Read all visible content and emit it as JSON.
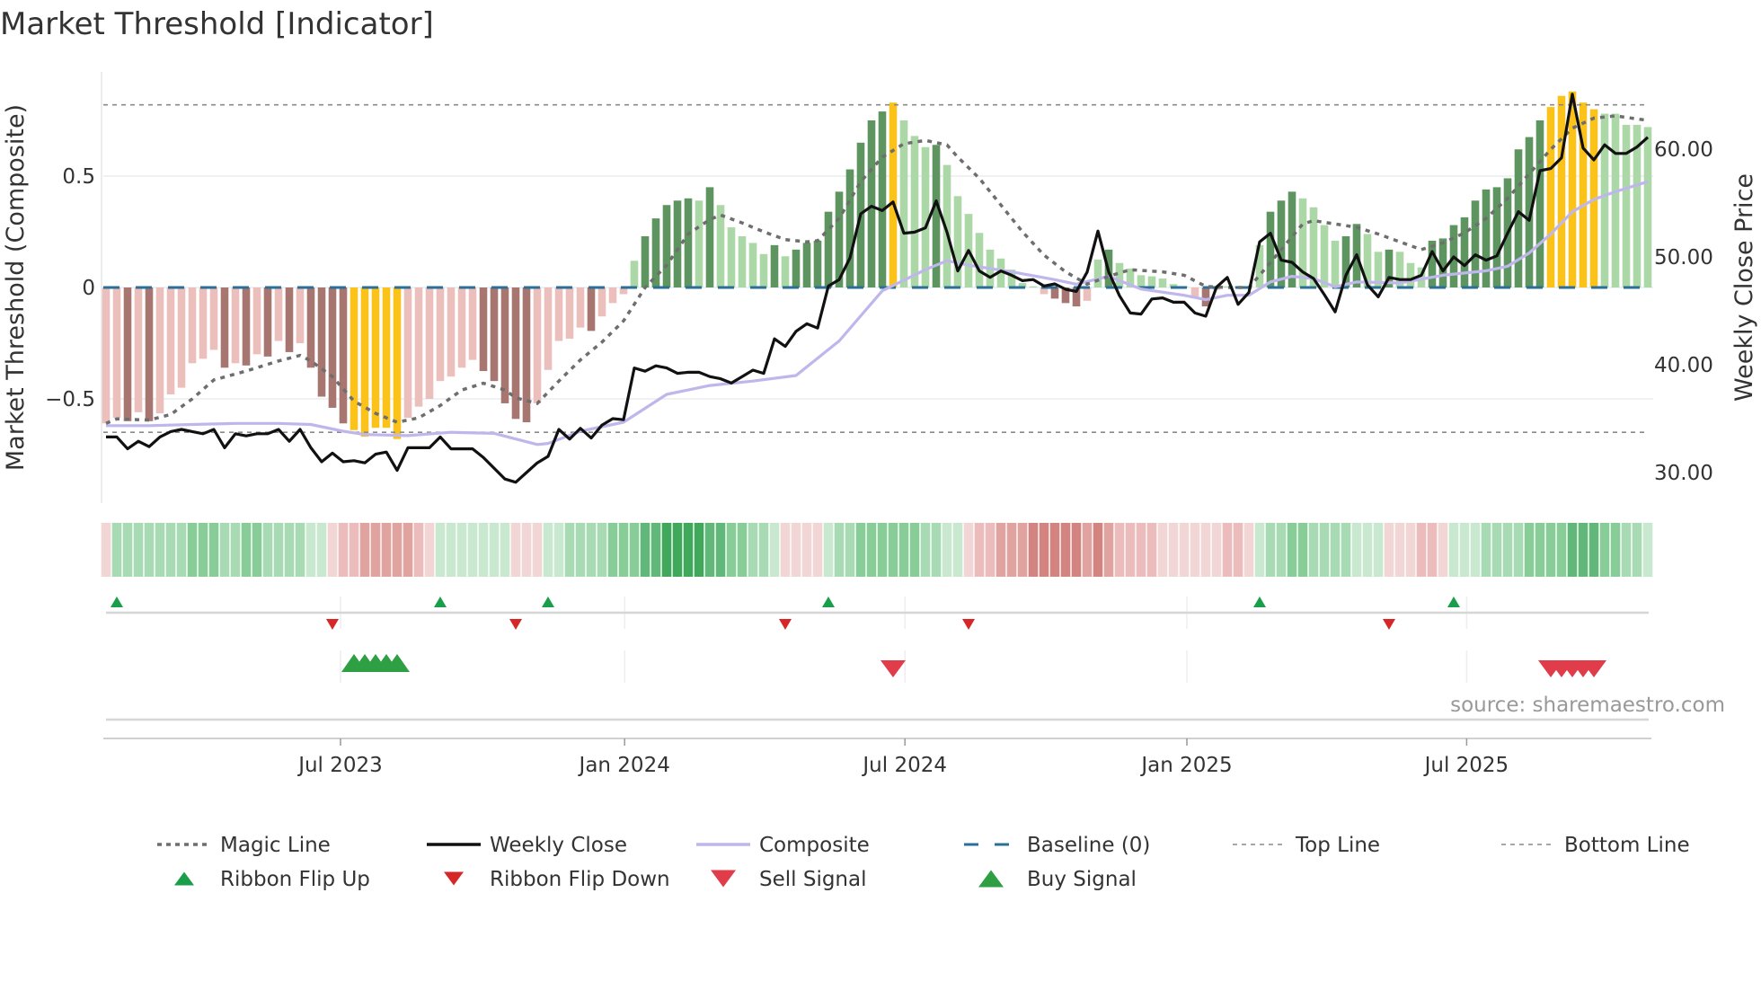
{
  "title": "Market Threshold [Indicator]",
  "source": "source: sharemaestro.com",
  "colors": {
    "bar_dark_neg": "#a87670",
    "bar_light_neg": "#ebc0bc",
    "bar_dark_pos": "#5e9460",
    "bar_light_pos": "#acd8a8",
    "bar_extreme": "#fbc31a",
    "magic": "#6e6e6e",
    "close": "#111111",
    "composite": "#bfb7ec",
    "baseline": "#2b6f98",
    "threshold": "#8a8a8a",
    "flip_up": "#1a9e4a",
    "flip_down": "#d62728",
    "buy": "#2ea043",
    "sell": "#e03c4a",
    "ribbon_pos": [
      "#c8e8cf",
      "#a8dab3",
      "#88cc98",
      "#62b87a",
      "#3fa85a"
    ],
    "ribbon_neg": [
      "#f2d6d6",
      "#ebbcbb",
      "#e0a3a0",
      "#d48480",
      "#c96a66"
    ]
  },
  "chart_data": {
    "type": "bar+line",
    "title": "Market Threshold [Indicator]",
    "x_unit": "week index (weekly bars)",
    "week_count": 144,
    "x_ticks": [
      {
        "label": "Jul 2023",
        "week": 22.75
      },
      {
        "label": "Jan 2024",
        "week": 49.1
      },
      {
        "label": "Jul 2024",
        "week": 75.1
      },
      {
        "label": "Jan 2025",
        "week": 101.25
      },
      {
        "label": "Jul 2025",
        "week": 127.2
      }
    ],
    "left_axis": {
      "label": "Market Threshold (Composite)",
      "ylim": [
        -1.0,
        1.0
      ],
      "ticks": [
        {
          "v": 0.5,
          "label": "0.5"
        },
        {
          "v": 0,
          "label": "0"
        },
        {
          "v": -0.5,
          "label": "−0.5"
        }
      ]
    },
    "right_axis": {
      "label": "Weekly Close Price",
      "ylim": [
        25,
        72
      ],
      "ticks": [
        {
          "v": 60,
          "label": "60.00"
        },
        {
          "v": 50,
          "label": "50.00"
        },
        {
          "v": 40,
          "label": "40.00"
        },
        {
          "v": 30,
          "label": "30.00"
        }
      ]
    },
    "top_line": 0.82,
    "bottom_line": -0.65,
    "baseline": 0,
    "bars": [
      -0.61,
      -0.585,
      -0.6,
      -0.56,
      -0.6,
      -0.565,
      -0.48,
      -0.45,
      -0.34,
      -0.32,
      -0.28,
      -0.36,
      -0.34,
      -0.35,
      -0.3,
      -0.31,
      -0.24,
      -0.29,
      -0.25,
      -0.36,
      -0.49,
      -0.54,
      -0.61,
      -0.64,
      -0.67,
      -0.63,
      -0.63,
      -0.68,
      -0.585,
      -0.535,
      -0.5,
      -0.42,
      -0.4,
      -0.36,
      -0.325,
      -0.375,
      -0.42,
      -0.52,
      -0.59,
      -0.605,
      -0.52,
      -0.37,
      -0.24,
      -0.23,
      -0.18,
      -0.195,
      -0.13,
      -0.07,
      -0.03,
      0.12,
      0.23,
      0.31,
      0.37,
      0.39,
      0.4,
      0.39,
      0.45,
      0.37,
      0.27,
      0.23,
      0.2,
      0.15,
      0.19,
      0.14,
      0.17,
      0.2,
      0.21,
      0.34,
      0.43,
      0.53,
      0.65,
      0.75,
      0.79,
      0.83,
      0.75,
      0.68,
      0.63,
      0.64,
      0.55,
      0.41,
      0.33,
      0.245,
      0.17,
      0.13,
      0.08,
      0.02,
      0.005,
      -0.03,
      -0.05,
      -0.07,
      -0.085,
      -0.06,
      0.125,
      0.17,
      0.11,
      0.085,
      0.055,
      0.05,
      0.04,
      0.015,
      0.005,
      -0.045,
      -0.085,
      -0.01,
      0.005,
      0.005,
      0.005,
      0.19,
      0.34,
      0.39,
      0.43,
      0.4,
      0.36,
      0.28,
      0.21,
      0.23,
      0.285,
      0.24,
      0.16,
      0.17,
      0.16,
      0.11,
      0.09,
      0.21,
      0.22,
      0.28,
      0.315,
      0.39,
      0.44,
      0.45,
      0.49,
      0.62,
      0.675,
      0.75,
      0.81,
      0.86,
      0.88,
      0.83,
      0.8,
      0.78,
      0.78,
      0.73,
      0.73,
      0.72
    ],
    "bar_shades": "LLDLDLLLLLLDLDLDLDLDDDDYYYYYLLLLLLLDDDDDLLLLLDLLLLDDDDDLDLLLLLDLDDDDDDDDDYLLLDLLLLLLLLLLDDDLLDLLLLLLLLDLLLLLDDDLLLLDDLLDLLLDDDDDDDDDDDYYYYYLLLLL",
    "weekly_close": [
      33.3,
      33.3,
      32.2,
      32.9,
      32.4,
      33.3,
      33.8,
      34.0,
      33.8,
      33.6,
      34.0,
      32.3,
      33.6,
      33.4,
      33.6,
      33.6,
      34.0,
      32.9,
      34.0,
      32.3,
      31.0,
      31.8,
      31.0,
      31.1,
      30.9,
      31.7,
      31.9,
      30.2,
      32.3,
      32.3,
      32.3,
      33.3,
      32.2,
      32.2,
      32.2,
      31.4,
      30.4,
      29.4,
      29.1,
      30.0,
      30.9,
      31.5,
      34.0,
      33.1,
      34.1,
      33.2,
      34.4,
      35.0,
      34.9,
      39.7,
      39.4,
      39.9,
      39.7,
      39.2,
      39.3,
      39.3,
      38.9,
      38.7,
      38.3,
      38.9,
      39.5,
      39.2,
      42.4,
      41.7,
      43.1,
      43.8,
      43.4,
      47.3,
      47.9,
      49.9,
      54.0,
      54.7,
      54.3,
      55.1,
      52.2,
      52.3,
      52.7,
      55.2,
      52.3,
      48.7,
      50.6,
      48.7,
      48.1,
      48.7,
      48.3,
      47.8,
      47.9,
      47.3,
      47.5,
      47.0,
      46.8,
      48.6,
      52.4,
      48.6,
      46.4,
      44.8,
      44.7,
      46.1,
      46.2,
      45.8,
      45.8,
      44.8,
      44.5,
      47.2,
      48.1,
      45.6,
      46.7,
      51.4,
      52.2,
      49.7,
      49.5,
      48.6,
      48.0,
      46.5,
      44.9,
      48.3,
      50.2,
      47.4,
      46.3,
      48.1,
      47.9,
      47.9,
      48.3,
      50.5,
      48.7,
      50.0,
      49.2,
      50.2,
      49.7,
      50.1,
      52.2,
      54.2,
      53.4,
      58.0,
      58.2,
      59.2,
      65.1,
      60.1,
      59.0,
      60.4,
      59.6,
      59.6,
      60.2,
      61.1
    ],
    "composite": [
      [
        1,
        -0.62
      ],
      [
        5,
        -0.62
      ],
      [
        9,
        -0.615
      ],
      [
        13,
        -0.61
      ],
      [
        17,
        -0.61
      ],
      [
        20,
        -0.615
      ],
      [
        23,
        -0.645
      ],
      [
        25,
        -0.66
      ],
      [
        29,
        -0.665
      ],
      [
        33,
        -0.65
      ],
      [
        37,
        -0.655
      ],
      [
        41,
        -0.705
      ],
      [
        42,
        -0.7
      ],
      [
        45,
        -0.645
      ],
      [
        49,
        -0.605
      ],
      [
        53,
        -0.48
      ],
      [
        57,
        -0.44
      ],
      [
        61,
        -0.42
      ],
      [
        65,
        -0.395
      ],
      [
        69,
        -0.24
      ],
      [
        73,
        -0.015
      ],
      [
        77,
        0.08
      ],
      [
        79,
        0.12
      ],
      [
        81,
        0.1
      ],
      [
        85,
        0.07
      ],
      [
        89,
        0.035
      ],
      [
        91,
        0.015
      ],
      [
        94,
        0.05
      ],
      [
        97,
        -0.007
      ],
      [
        101,
        -0.035
      ],
      [
        103,
        -0.055
      ],
      [
        105,
        -0.035
      ],
      [
        107,
        -0.035
      ],
      [
        109,
        0.025
      ],
      [
        111,
        0.05
      ],
      [
        113,
        0.04
      ],
      [
        115,
        0.003
      ],
      [
        117,
        0.025
      ],
      [
        121,
        0.02
      ],
      [
        125,
        0.055
      ],
      [
        129,
        0.075
      ],
      [
        131,
        0.095
      ],
      [
        133,
        0.155
      ],
      [
        135,
        0.24
      ],
      [
        137,
        0.34
      ],
      [
        139,
        0.395
      ],
      [
        141,
        0.43
      ],
      [
        144,
        0.475
      ]
    ],
    "magic_line": [
      [
        1,
        -0.61
      ],
      [
        2,
        -0.59
      ],
      [
        5,
        -0.595
      ],
      [
        7,
        -0.57
      ],
      [
        9,
        -0.5
      ],
      [
        11,
        -0.415
      ],
      [
        14,
        -0.375
      ],
      [
        17,
        -0.33
      ],
      [
        19,
        -0.305
      ],
      [
        20,
        -0.33
      ],
      [
        22,
        -0.4
      ],
      [
        24,
        -0.51
      ],
      [
        26,
        -0.565
      ],
      [
        28,
        -0.605
      ],
      [
        30,
        -0.585
      ],
      [
        32,
        -0.53
      ],
      [
        34,
        -0.46
      ],
      [
        36,
        -0.43
      ],
      [
        38,
        -0.46
      ],
      [
        39,
        -0.495
      ],
      [
        41,
        -0.52
      ],
      [
        43,
        -0.42
      ],
      [
        45,
        -0.325
      ],
      [
        47,
        -0.245
      ],
      [
        49,
        -0.15
      ],
      [
        51,
        0
      ],
      [
        53,
        0.1
      ],
      [
        55,
        0.24
      ],
      [
        57,
        0.305
      ],
      [
        58,
        0.325
      ],
      [
        60,
        0.29
      ],
      [
        62,
        0.25
      ],
      [
        64,
        0.215
      ],
      [
        66,
        0.205
      ],
      [
        67,
        0.21
      ],
      [
        69,
        0.31
      ],
      [
        71,
        0.475
      ],
      [
        73,
        0.585
      ],
      [
        75,
        0.645
      ],
      [
        77,
        0.66
      ],
      [
        79,
        0.64
      ],
      [
        80,
        0.585
      ],
      [
        82,
        0.49
      ],
      [
        84,
        0.37
      ],
      [
        86,
        0.25
      ],
      [
        88,
        0.145
      ],
      [
        90,
        0.07
      ],
      [
        92,
        0.015
      ],
      [
        94,
        0.05
      ],
      [
        96,
        0.08
      ],
      [
        99,
        0.07
      ],
      [
        101,
        0.055
      ],
      [
        103,
        0.005
      ],
      [
        105,
        0
      ],
      [
        107,
        0
      ],
      [
        108,
        0.055
      ],
      [
        110,
        0.17
      ],
      [
        112,
        0.285
      ],
      [
        113,
        0.3
      ],
      [
        115,
        0.285
      ],
      [
        117,
        0.27
      ],
      [
        119,
        0.24
      ],
      [
        121,
        0.205
      ],
      [
        123,
        0.17
      ],
      [
        125,
        0.2
      ],
      [
        127,
        0.245
      ],
      [
        129,
        0.31
      ],
      [
        131,
        0.4
      ],
      [
        133,
        0.51
      ],
      [
        135,
        0.62
      ],
      [
        137,
        0.715
      ],
      [
        139,
        0.76
      ],
      [
        141,
        0.77
      ],
      [
        144,
        0.75
      ]
    ],
    "ribbon": [
      -1,
      2,
      2,
      2,
      2,
      2,
      2,
      2,
      3,
      3,
      3,
      2,
      2,
      3,
      3,
      2,
      2,
      2,
      2,
      1,
      1,
      -1,
      -2,
      -2,
      -3,
      -3,
      -3,
      -3,
      -3,
      -2,
      -1,
      1,
      1,
      1,
      1,
      1,
      1,
      1,
      -1,
      -1,
      -1,
      1,
      1,
      2,
      2,
      2,
      2,
      3,
      3,
      3,
      4,
      4,
      5,
      5,
      5,
      5,
      4,
      4,
      3,
      3,
      2,
      2,
      1,
      -1,
      -1,
      -1,
      -1,
      1,
      2,
      2,
      3,
      3,
      3,
      3,
      3,
      3,
      2,
      2,
      1,
      1,
      -1,
      -2,
      -2,
      -3,
      -3,
      -3,
      -4,
      -4,
      -4,
      -4,
      -4,
      -3,
      -4,
      -3,
      -2,
      -2,
      -2,
      -2,
      -1,
      -1,
      -1,
      -1,
      -1,
      -1,
      -2,
      -2,
      -1,
      1,
      2,
      2,
      3,
      3,
      2,
      2,
      2,
      2,
      1,
      1,
      1,
      -1,
      -1,
      -1,
      -2,
      -2,
      -1,
      1,
      1,
      1,
      2,
      2,
      2,
      2,
      3,
      3,
      3,
      3,
      4,
      4,
      4,
      3,
      3,
      2,
      2,
      1
    ],
    "ribbon_flip_up_weeks": [
      2,
      32,
      42,
      68,
      108,
      126
    ],
    "ribbon_flip_down_weeks": [
      22,
      39,
      64,
      81,
      120
    ],
    "buy_signal_weeks": [
      24,
      25,
      26,
      27,
      28
    ],
    "sell_signal_weeks": [
      74,
      135,
      136,
      137,
      138,
      139
    ]
  },
  "legend": [
    {
      "label": "Magic Line",
      "type": "dotted"
    },
    {
      "label": "Weekly Close",
      "type": "solid"
    },
    {
      "label": "Composite",
      "type": "lavender"
    },
    {
      "label": "Baseline (0)",
      "type": "dashed"
    },
    {
      "label": "Top Line",
      "type": "thin-dashed"
    },
    {
      "label": "Bottom Line",
      "type": "thin-dashed"
    },
    {
      "label": "Ribbon Flip Up",
      "type": "tri-up-small"
    },
    {
      "label": "Ribbon Flip Down",
      "type": "tri-down-small"
    },
    {
      "label": "Sell Signal",
      "type": "tri-down-big"
    },
    {
      "label": "Buy Signal",
      "type": "tri-up-big"
    }
  ]
}
